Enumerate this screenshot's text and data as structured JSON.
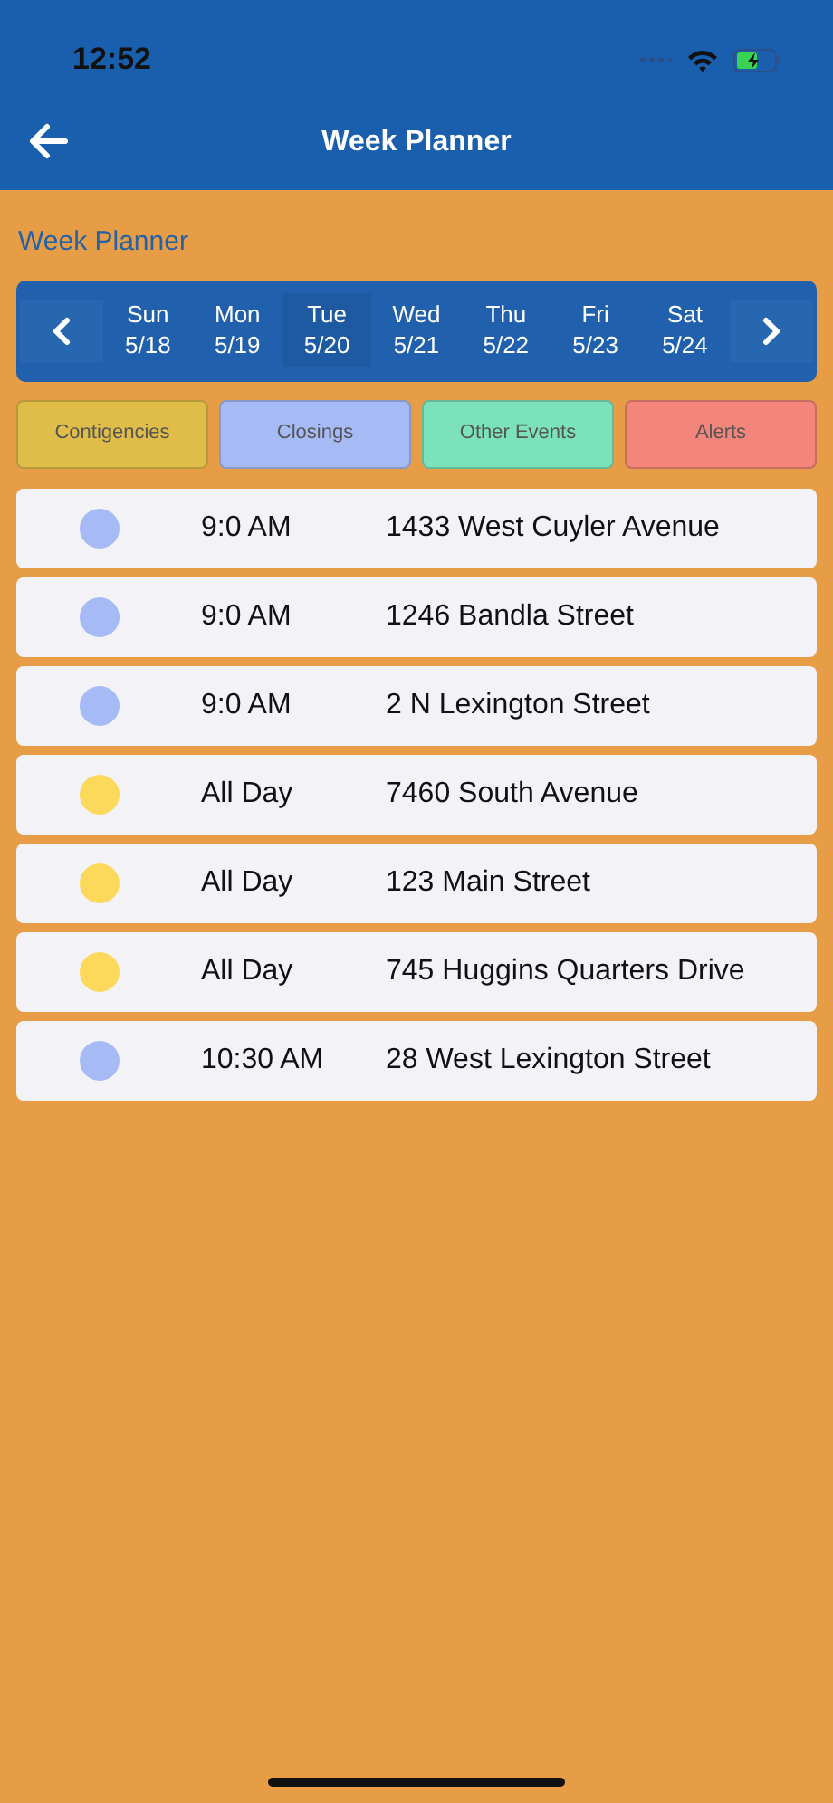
{
  "status_bar": {
    "time": "12:52"
  },
  "header": {
    "title": "Week Planner"
  },
  "page_title": "Week Planner",
  "days": [
    {
      "day": "Sun",
      "date": "5/18",
      "selected": false
    },
    {
      "day": "Mon",
      "date": "5/19",
      "selected": false
    },
    {
      "day": "Tue",
      "date": "5/20",
      "selected": true
    },
    {
      "day": "Wed",
      "date": "5/21",
      "selected": false
    },
    {
      "day": "Thu",
      "date": "5/22",
      "selected": false
    },
    {
      "day": "Fri",
      "date": "5/23",
      "selected": false
    },
    {
      "day": "Sat",
      "date": "5/24",
      "selected": false
    }
  ],
  "filters": [
    {
      "label": "Contigencies",
      "color": "#e0bc48"
    },
    {
      "label": "Closings",
      "color": "#a6baf5"
    },
    {
      "label": "Other Events",
      "color": "#7ce2bb"
    },
    {
      "label": "Alerts",
      "color": "#f3857a"
    }
  ],
  "events": [
    {
      "time": "9:0 AM",
      "address": "1433 West Cuyler Avenue",
      "color": "#a6baf5"
    },
    {
      "time": "9:0 AM",
      "address": "1246 Bandla Street",
      "color": "#a6baf5"
    },
    {
      "time": "9:0 AM",
      "address": "2 N Lexington Street",
      "color": "#a6baf5"
    },
    {
      "time": "All Day",
      "address": "7460 South Avenue",
      "color": "#fcd95a"
    },
    {
      "time": "All Day",
      "address": "123 Main Street",
      "color": "#fcd95a"
    },
    {
      "time": "All Day",
      "address": "745 Huggins Quarters Drive",
      "color": "#fcd95a"
    },
    {
      "time": "10:30 AM",
      "address": "28 West Lexington Street",
      "color": "#a6baf5"
    }
  ]
}
